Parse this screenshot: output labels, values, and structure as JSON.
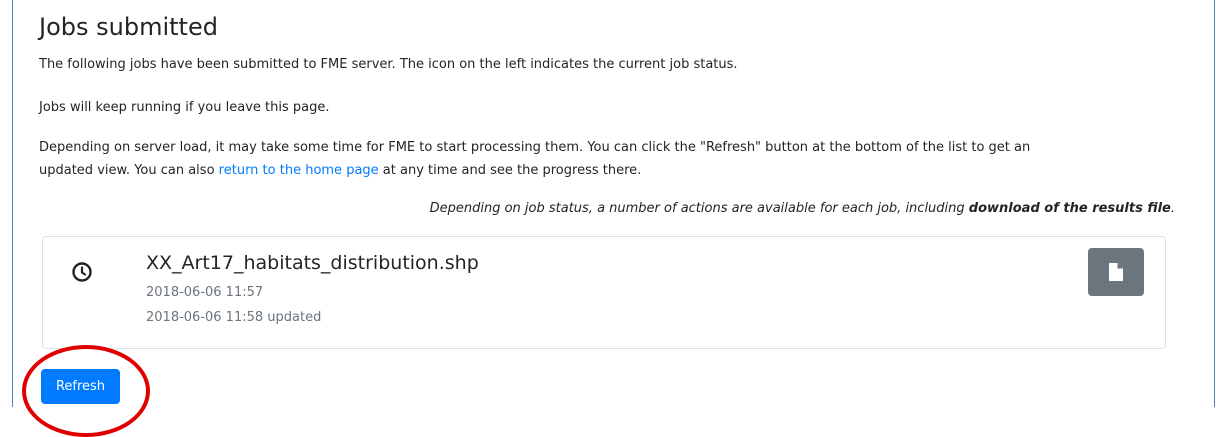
{
  "page": {
    "title": "Jobs submitted",
    "intro": "The following jobs have been submitted to FME server. The icon on the left indicates the current job status.",
    "keep_running": "Jobs will keep running if you leave this page.",
    "load_note_line1": "Depending on server load, it may take some time for FME to start processing them. You can click the \"Refresh\" button at the bottom of the list to get an",
    "load_note_line2_prefix": "updated view. You can also ",
    "home_link": "return to the home page",
    "load_note_line2_suffix": " at any time and see the progress there.",
    "actions_note_prefix": "Depending on job status, a number of actions are available for each job, including ",
    "actions_note_bold": "download of the results file",
    "actions_note_suffix": "."
  },
  "job": {
    "status_icon": "clock-icon",
    "name": "XX_Art17_habitats_distribution.shp",
    "submitted": "2018-06-06 11:57",
    "updated": "2018-06-06 11:58 updated",
    "action_icon": "file-icon"
  },
  "refresh_label": "Refresh",
  "colors": {
    "primary": "#007bff",
    "secondary": "#6c757d",
    "annotation": "#e00000"
  }
}
